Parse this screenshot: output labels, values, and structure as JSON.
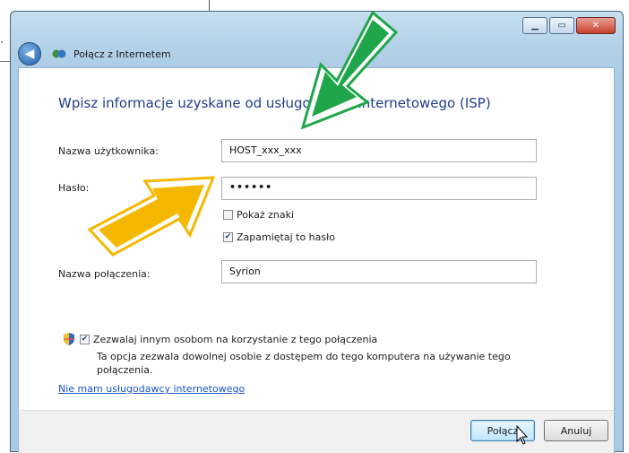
{
  "window": {
    "title": "Połącz z Internetem",
    "controls": [
      "minimize",
      "maximize",
      "close"
    ]
  },
  "form": {
    "heading": "Wpisz informacje uzyskane od usługodawcy internetowego (ISP)",
    "username_label": "Nazwa użytkownika:",
    "username_value": "HOST_xxx_xxx",
    "password_label": "Hasło:",
    "password_value": "••••••",
    "show_chars_label": "Pokaż znaki",
    "show_chars_checked": false,
    "remember_label": "Zapamiętaj to hasło",
    "remember_checked": true,
    "connection_name_label": "Nazwa połączenia:",
    "connection_name_value": "Syrion",
    "allow_others_label": "Zezwalaj innym osobom na korzystanie z tego połączenia",
    "allow_others_checked": true,
    "allow_others_desc": "Ta opcja zezwala dowolnej osobie z dostępem do tego komputera na używanie tego połączenia.",
    "no_isp_link": "Nie mam usługodawcy internetowego"
  },
  "footer": {
    "connect_label": "Połącz",
    "cancel_label": "Anuluj"
  },
  "annotations": {
    "green_arrow_color": "#1fa64a",
    "yellow_arrow_color": "#f5b800"
  },
  "icons": {
    "back": "back-arrow-icon",
    "network": "network-globe-icon",
    "shield": "uac-shield-icon",
    "cursor": "mouse-pointer-icon"
  }
}
